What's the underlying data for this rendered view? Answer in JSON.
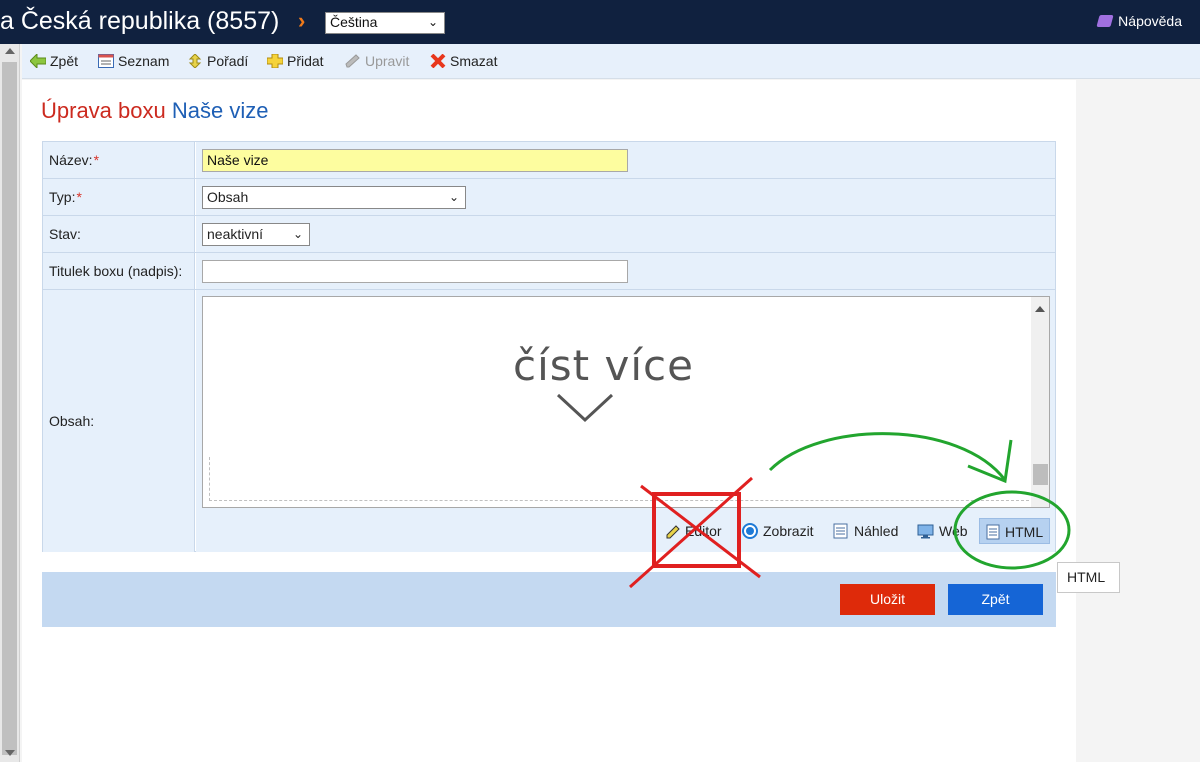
{
  "header": {
    "brand": "a Česká republika (8557)",
    "chevron": "›",
    "language": "Čeština",
    "help": "Nápověda"
  },
  "toolbar": {
    "back": "Zpět",
    "list": "Seznam",
    "order": "Pořadí",
    "add": "Přidat",
    "edit": "Upravit",
    "delete": "Smazat"
  },
  "page": {
    "title_lead": "Úprava boxu",
    "title_name": "Naše vize"
  },
  "form": {
    "name_label": "Název:",
    "name_value": "Naše vize",
    "type_label": "Typ:",
    "type_value": "Obsah",
    "status_label": "Stav:",
    "status_value": "neaktivní",
    "caption_label": "Titulek boxu (nadpis):",
    "caption_value": "",
    "content_label": "Obsah:",
    "content_preview": "číst více",
    "required_mark": "*"
  },
  "view_modes": {
    "editor": "Editor",
    "display": "Zobrazit",
    "preview": "Náhled",
    "web": "Web",
    "html": "HTML"
  },
  "buttons": {
    "save": "Uložit",
    "back": "Zpět"
  },
  "tooltip": "HTML",
  "colors": {
    "header_bg": "#10213f",
    "accent_orange": "#f07a1a",
    "title_red": "#cc2a1f",
    "title_blue": "#1e5fb5",
    "save_red": "#de2a0a",
    "back_blue": "#1565d6",
    "annotation_red": "#e02020",
    "annotation_green": "#22a52e"
  }
}
